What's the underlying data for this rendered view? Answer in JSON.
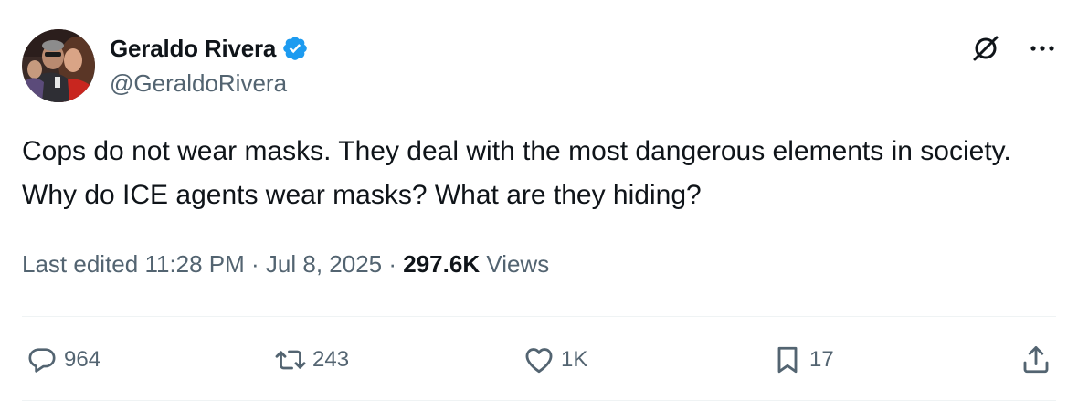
{
  "author": {
    "display_name": "Geraldo Rivera",
    "handle": "@GeraldoRivera",
    "verified": true
  },
  "tweet": {
    "text": "Cops do not wear masks. They deal with the most dangerous elements in society. Why do ICE agents wear masks? What are they hiding?",
    "edited_label": "Last edited",
    "time": "11:28 PM",
    "separator": " · ",
    "date": "Jul 8, 2025",
    "views_count": "297.6K",
    "views_label": "Views"
  },
  "actions": {
    "replies": "964",
    "reposts": "243",
    "likes": "1K",
    "bookmarks": "17"
  },
  "icons": {
    "grok": "grok-icon",
    "more": "more-icon",
    "reply": "reply-icon",
    "repost": "repost-icon",
    "like": "heart-icon",
    "bookmark": "bookmark-icon",
    "share": "share-icon",
    "verified": "verified-badge-icon"
  },
  "colors": {
    "text_primary": "#0f1419",
    "text_secondary": "#536471",
    "verified_blue": "#1d9bf0",
    "divider": "#eff3f4"
  }
}
